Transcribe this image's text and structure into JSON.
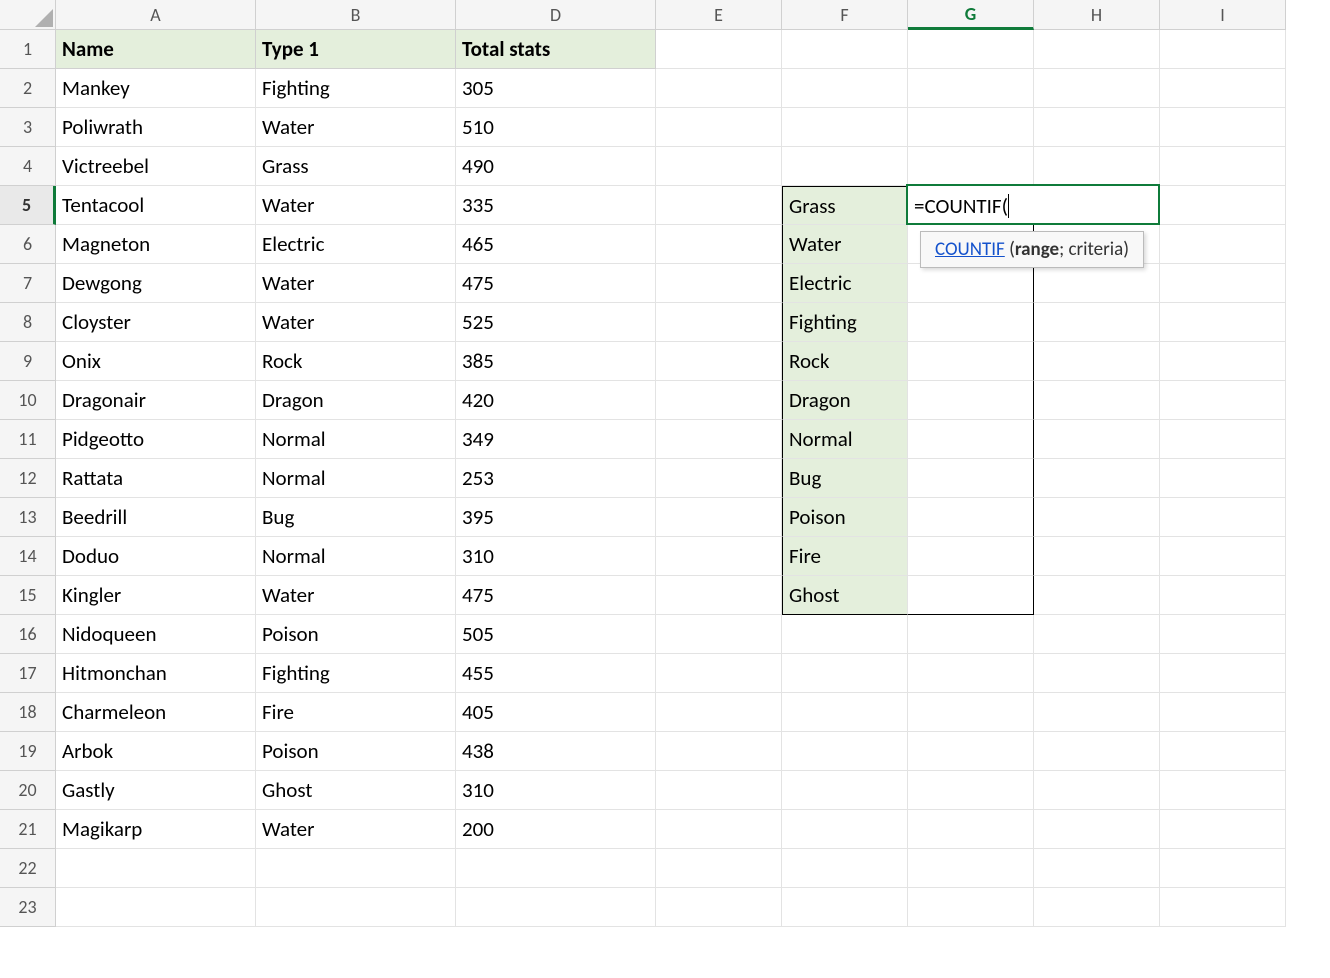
{
  "columns": [
    "A",
    "B",
    "D",
    "E",
    "F",
    "G",
    "H",
    "I"
  ],
  "active_column": "G",
  "active_row": 5,
  "row_count": 23,
  "headers": {
    "A": "Name",
    "B": "Type 1",
    "D": "Total stats"
  },
  "rows": [
    {
      "name": "Mankey",
      "type": "Fighting",
      "stats": "305"
    },
    {
      "name": "Poliwrath",
      "type": "Water",
      "stats": "510"
    },
    {
      "name": "Victreebel",
      "type": "Grass",
      "stats": "490"
    },
    {
      "name": "Tentacool",
      "type": "Water",
      "stats": "335"
    },
    {
      "name": "Magneton",
      "type": "Electric",
      "stats": "465"
    },
    {
      "name": "Dewgong",
      "type": "Water",
      "stats": "475"
    },
    {
      "name": "Cloyster",
      "type": "Water",
      "stats": "525"
    },
    {
      "name": "Onix",
      "type": "Rock",
      "stats": "385"
    },
    {
      "name": "Dragonair",
      "type": "Dragon",
      "stats": "420"
    },
    {
      "name": "Pidgeotto",
      "type": "Normal",
      "stats": "349"
    },
    {
      "name": "Rattata",
      "type": "Normal",
      "stats": "253"
    },
    {
      "name": "Beedrill",
      "type": "Bug",
      "stats": "395"
    },
    {
      "name": "Doduo",
      "type": "Normal",
      "stats": "310"
    },
    {
      "name": "Kingler",
      "type": "Water",
      "stats": "475"
    },
    {
      "name": "Nidoqueen",
      "type": "Poison",
      "stats": "505"
    },
    {
      "name": "Hitmonchan",
      "type": "Fighting",
      "stats": "455"
    },
    {
      "name": "Charmeleon",
      "type": "Fire",
      "stats": "405"
    },
    {
      "name": "Arbok",
      "type": "Poison",
      "stats": "438"
    },
    {
      "name": "Gastly",
      "type": "Ghost",
      "stats": "310"
    },
    {
      "name": "Magikarp",
      "type": "Water",
      "stats": "200"
    }
  ],
  "categories": [
    "Grass",
    "Water",
    "Electric",
    "Fighting",
    "Rock",
    "Dragon",
    "Normal",
    "Bug",
    "Poison",
    "Fire",
    "Ghost"
  ],
  "formula_entry": "=COUNTIF(",
  "tooltip": {
    "fn_link": "COUNTIF",
    "open": " (",
    "arg_bold": "range",
    "rest": "; criteria)"
  }
}
